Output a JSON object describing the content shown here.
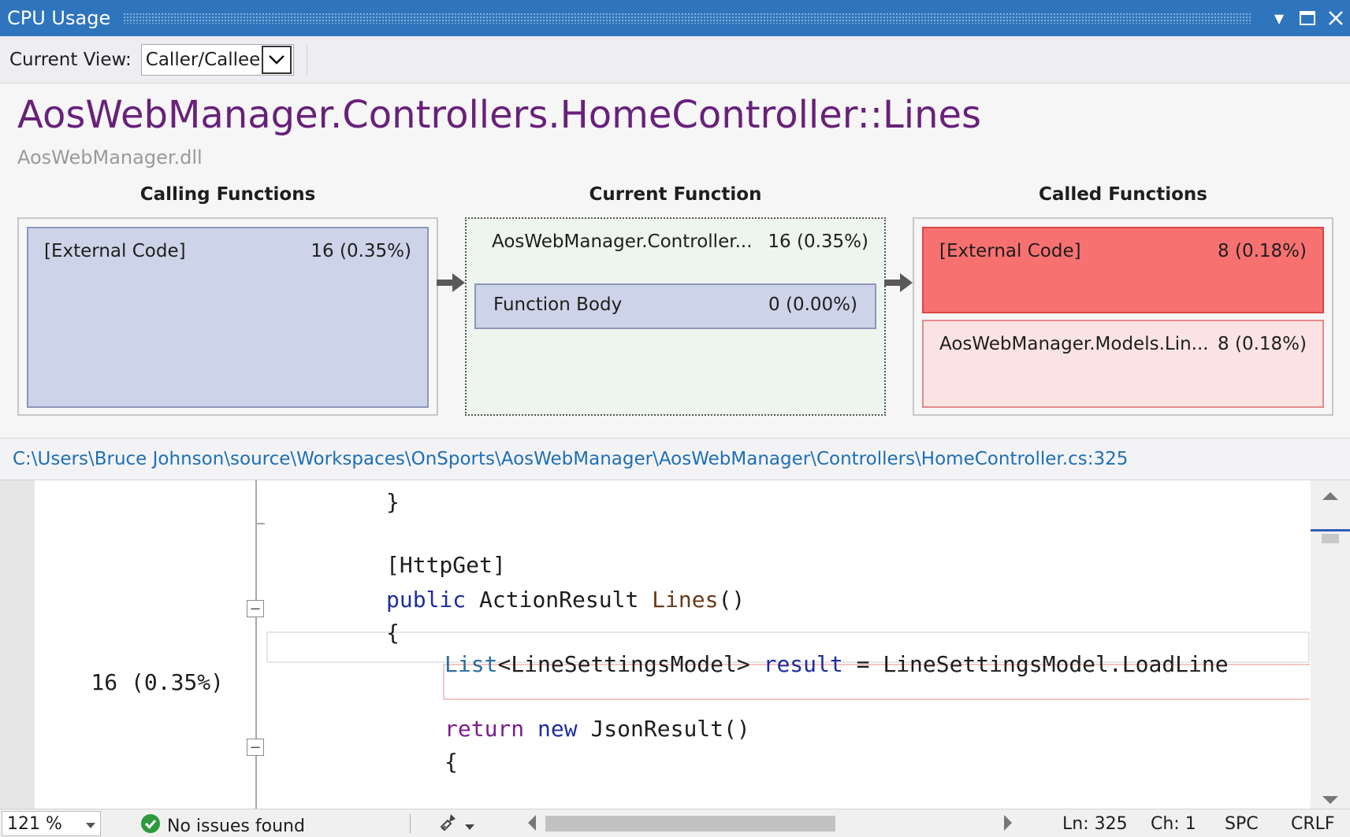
{
  "window": {
    "title": "CPU Usage",
    "dropdown_icon": "▼",
    "maximize_icon": "□",
    "close_icon": "✕"
  },
  "toolbar": {
    "current_view_label": "Current View:",
    "current_view_value": "Caller/Callee"
  },
  "function": {
    "name": "AosWebManager.Controllers.HomeController::Lines",
    "module": "AosWebManager.dll"
  },
  "columns": {
    "calling": "Calling Functions",
    "current": "Current Function",
    "called": "Called Functions"
  },
  "calling": [
    {
      "name": "[External Code]",
      "value": "16 (0.35%)"
    }
  ],
  "current": {
    "name": "AosWebManager.Controller...",
    "value": "16 (0.35%)",
    "body_label": "Function Body",
    "body_value": "0 (0.00%)"
  },
  "called": [
    {
      "name": "[External Code]",
      "value": "8 (0.18%)"
    },
    {
      "name": "AosWebManager.Models.Lin...",
      "value": "8 (0.18%)"
    }
  ],
  "colors": {
    "hot": "#f87171",
    "warm": "#fbe3e3",
    "calling": "#cdd3e8",
    "current_bg": "#eef5ee",
    "accent": "#2f75bd",
    "title": "#68217a"
  },
  "source_path": "C:\\Users\\Bruce Johnson\\source\\Workspaces\\OnSports\\AosWebManager\\AosWebManager\\Controllers\\HomeController.cs:325",
  "code": {
    "l1": "}",
    "l2": "[HttpGet]",
    "l3_kw": "public",
    "l3_type": "ActionResult",
    "l3_method": "Lines",
    "l3_tail": "()",
    "l4": "{",
    "l5_type": "List",
    "l5_generic": "<LineSettingsModel>",
    "l5_var": "result",
    "l5_tail": " = LineSettingsModel.LoadLine",
    "l6_kw": "return",
    "l6_new": "new",
    "l6_tail": " JsonResult()",
    "l7": "{",
    "line_metric": "16 (0.35%)"
  },
  "status": {
    "zoom": "121 %",
    "issues": "No issues found",
    "ln": "Ln: 325",
    "ch": "Ch: 1",
    "spc": "SPC",
    "crlf": "CRLF"
  }
}
